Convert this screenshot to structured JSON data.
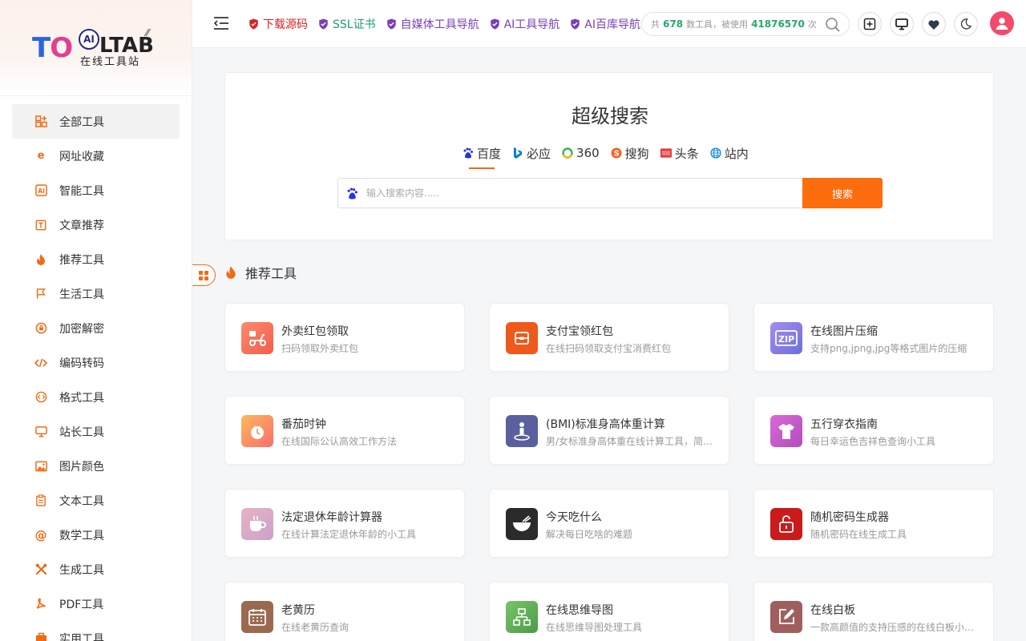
{
  "brand": {
    "logo_main": "TO",
    "logo_ai": "AI",
    "logo_rest": "LTAB",
    "logo_sub": "在线工具站"
  },
  "sidebar": {
    "items": [
      {
        "label": "全部工具",
        "icon": "grid-plus-icon",
        "active": true
      },
      {
        "label": "网址收藏",
        "icon": "ie-icon"
      },
      {
        "label": "智能工具",
        "icon": "ai-box-icon"
      },
      {
        "label": "文章推荐",
        "icon": "article-icon"
      },
      {
        "label": "推荐工具",
        "icon": "fire-icon"
      },
      {
        "label": "生活工具",
        "icon": "flag-icon"
      },
      {
        "label": "加密解密",
        "icon": "lock-circle-icon"
      },
      {
        "label": "编码转码",
        "icon": "code-icon"
      },
      {
        "label": "格式工具",
        "icon": "code-circle-icon"
      },
      {
        "label": "站长工具",
        "icon": "monitor-icon"
      },
      {
        "label": "图片颜色",
        "icon": "image-icon"
      },
      {
        "label": "文本工具",
        "icon": "clipboard-icon"
      },
      {
        "label": "数学工具",
        "icon": "at-icon"
      },
      {
        "label": "生成工具",
        "icon": "tools-icon"
      },
      {
        "label": "PDF工具",
        "icon": "pdf-icon"
      },
      {
        "label": "实用工具",
        "icon": "briefcase-icon"
      }
    ]
  },
  "header": {
    "links": [
      {
        "label": "下载源码",
        "color": "#e02020"
      },
      {
        "label": "SSL证书",
        "color": "#1a9e6e"
      },
      {
        "label": "自媒体工具导航",
        "color": "#7b3fb5"
      },
      {
        "label": "AI工具导航",
        "color": "#7b3fb5"
      },
      {
        "label": "AI百库导航",
        "color": "#7b3fb5"
      }
    ],
    "stats": {
      "prefix": "共",
      "tools_count": "678",
      "middle": "数工具，被使用",
      "uses_count": "41876570",
      "suffix": "次"
    }
  },
  "search": {
    "title": "超级搜索",
    "engines": [
      {
        "label": "百度",
        "icon": "baidu-icon",
        "active": true
      },
      {
        "label": "必应",
        "icon": "bing-icon"
      },
      {
        "label": "360",
        "icon": "360-icon"
      },
      {
        "label": "搜狗",
        "icon": "sogou-icon"
      },
      {
        "label": "头条",
        "icon": "toutiao-icon"
      },
      {
        "label": "站内",
        "icon": "globe-icon"
      }
    ],
    "placeholder": "输入搜索内容.....",
    "button": "搜索"
  },
  "section": {
    "title": "推荐工具"
  },
  "tools": [
    {
      "title": "外卖红包领取",
      "desc": "扫码领取外卖红包",
      "icon": "scooter-icon",
      "color": "#f8705c"
    },
    {
      "title": "支付宝领红包",
      "desc": "在线扫码领取支付宝消费红包",
      "icon": "wallet-icon",
      "color": "#ee5a1c"
    },
    {
      "title": "在线图片压缩",
      "desc": "支持png,jpng,jpg等格式图片的压缩",
      "icon": "zip-icon",
      "color": "#8a7de6"
    },
    {
      "title": "番茄时钟",
      "desc": "在线国际公认高效工作方法",
      "icon": "tomato-icon",
      "color": "#fb8a5a"
    },
    {
      "title": "(BMI)标准身高体重计算",
      "desc": "男/女标准身高体重在线计算工具，简单...",
      "icon": "person-icon",
      "color": "#5a5f9e"
    },
    {
      "title": "五行穿衣指南",
      "desc": "每日幸运色吉祥色查询小工具",
      "icon": "shirt-icon",
      "color": "#c856c9"
    },
    {
      "title": "法定退休年龄计算器",
      "desc": "在线计算法定退休年龄的小工具",
      "icon": "cup-icon",
      "color": "#d9a2b5"
    },
    {
      "title": "今天吃什么",
      "desc": "解决每日吃啥的难题",
      "icon": "bowl-icon",
      "color": "#2b2b2b"
    },
    {
      "title": "随机密码生成器",
      "desc": "随机密码在线生成工具",
      "icon": "padlock-icon",
      "color": "#c91b1b"
    },
    {
      "title": "老黄历",
      "desc": "在线老黄历查询",
      "icon": "calendar-icon",
      "color": "#9b6a4e"
    },
    {
      "title": "在线思维导图",
      "desc": "在线思维导图处理工具",
      "icon": "mindmap-icon",
      "color": "#5fae5a"
    },
    {
      "title": "在线白板",
      "desc": "一款高颜值的支持压感的在线白板小工具",
      "icon": "pen-board-icon",
      "color": "#a05f5f"
    }
  ]
}
